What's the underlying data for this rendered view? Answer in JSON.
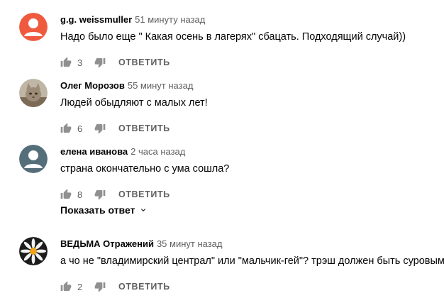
{
  "actions": {
    "reply_label": "ОТВЕТИТЬ"
  },
  "comments": [
    {
      "author": "g.g. weissmuller",
      "time": "51 минуту назад",
      "text": "Надо было еще \" Какая осень в лагерях\" сбацать. Подходящий случай))",
      "likes": "3",
      "avatar": "default-orange",
      "avatar_color": "#ef5a3f"
    },
    {
      "author": "Олег Морозов",
      "time": "55 минут назад",
      "text": "Людей обыдляют с малых лет!",
      "likes": "6",
      "avatar": "photo-cat"
    },
    {
      "author": "елена иванова",
      "time": "2 часа назад",
      "text": "страна окончательно с ума сошла?",
      "likes": "8",
      "avatar": "default-slate",
      "avatar_color": "#546e7a"
    },
    {
      "author": "ВЕДЬМА Отражений",
      "time": "35 минут назад",
      "text": "а чо не \"владимирский централ\" или \"мальчик-гей\"?  трэш должен быть суровым.",
      "likes": "2",
      "avatar": "photo-daisy"
    }
  ],
  "show_replies_label": "Показать ответ",
  "colors": {
    "text_primary": "#030303",
    "text_secondary": "#606060",
    "icon": "#909090"
  },
  "icons": [
    "thumb-up-icon",
    "thumb-down-icon",
    "chevron-down-icon",
    "person-icon"
  ]
}
